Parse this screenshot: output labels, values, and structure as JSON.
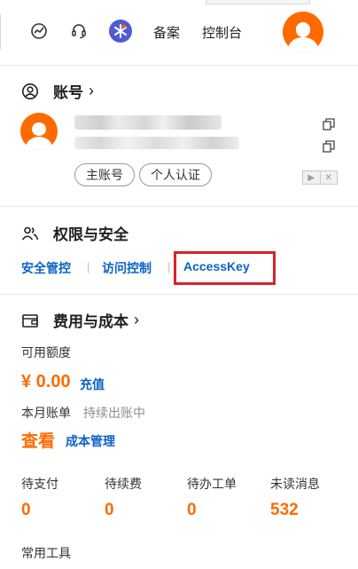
{
  "topbar": {
    "icons": [
      "chart-icon",
      "headset-icon",
      "cloud-assistant-icon"
    ],
    "filing_label": "备案",
    "console_label": "控制台"
  },
  "account": {
    "title": "账号",
    "tags": [
      "主账号",
      "个人认证"
    ]
  },
  "permissions": {
    "title": "权限与安全",
    "links": [
      "安全管控",
      "访问控制",
      "AccessKey"
    ]
  },
  "costs": {
    "title": "费用与成本",
    "available_label": "可用额度",
    "available_amount": "¥ 0.00",
    "recharge_label": "充值",
    "monthly_bill_label": "本月账单",
    "billing_status": "持续出账中",
    "view_label": "查看",
    "cost_mgmt_label": "成本管理",
    "stats": [
      {
        "label": "待支付",
        "value": "0"
      },
      {
        "label": "待续费",
        "value": "0"
      },
      {
        "label": "待办工单",
        "value": "0"
      },
      {
        "label": "未读消息",
        "value": "532"
      }
    ]
  },
  "tools": {
    "title": "常用工具"
  },
  "colors": {
    "accent": "#ff6a00",
    "link": "#0b63c4",
    "highlight": "#d9232b"
  }
}
